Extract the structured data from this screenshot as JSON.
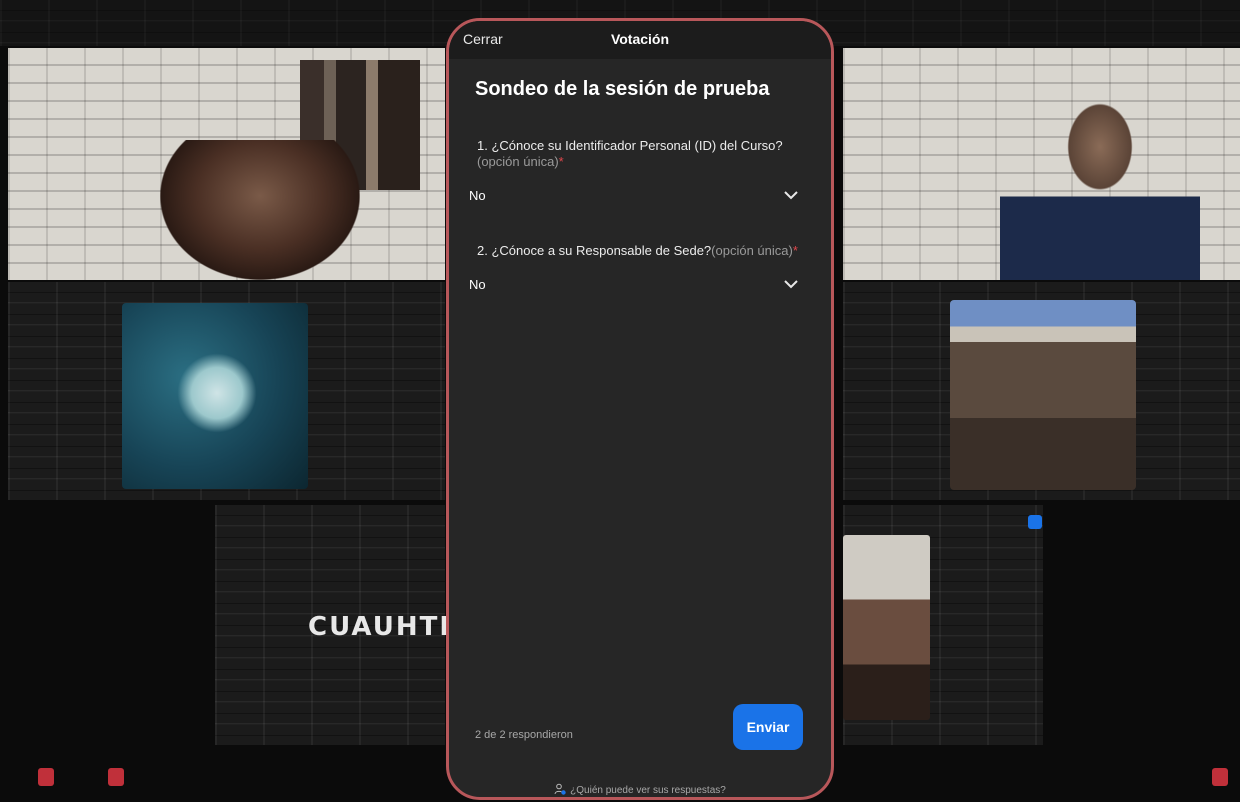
{
  "background": {
    "participant_name_partial": "CUAUHTE"
  },
  "poll": {
    "close_label": "Cerrar",
    "header_title": "Votación",
    "survey_title": "Sondeo de la sesión de prueba",
    "questions": [
      {
        "text": "1. ¿Cónoce su Identificador Personal (ID) del Curso?",
        "hint": "(opción única)",
        "required_mark": "*",
        "selected": "No"
      },
      {
        "text": "2. ¿Cónoce a su Responsable de Sede?",
        "hint": "(opción única)",
        "required_mark": "*",
        "selected": "No"
      }
    ],
    "responded_text": "2 de 2 respondieron",
    "send_label": "Enviar",
    "who_can_see": "¿Quién puede ver sus respuestas?",
    "colors": {
      "accent": "#1a73e8",
      "required": "#e0474c",
      "panel_border": "#b8575a",
      "panel_bg": "#262626"
    }
  }
}
